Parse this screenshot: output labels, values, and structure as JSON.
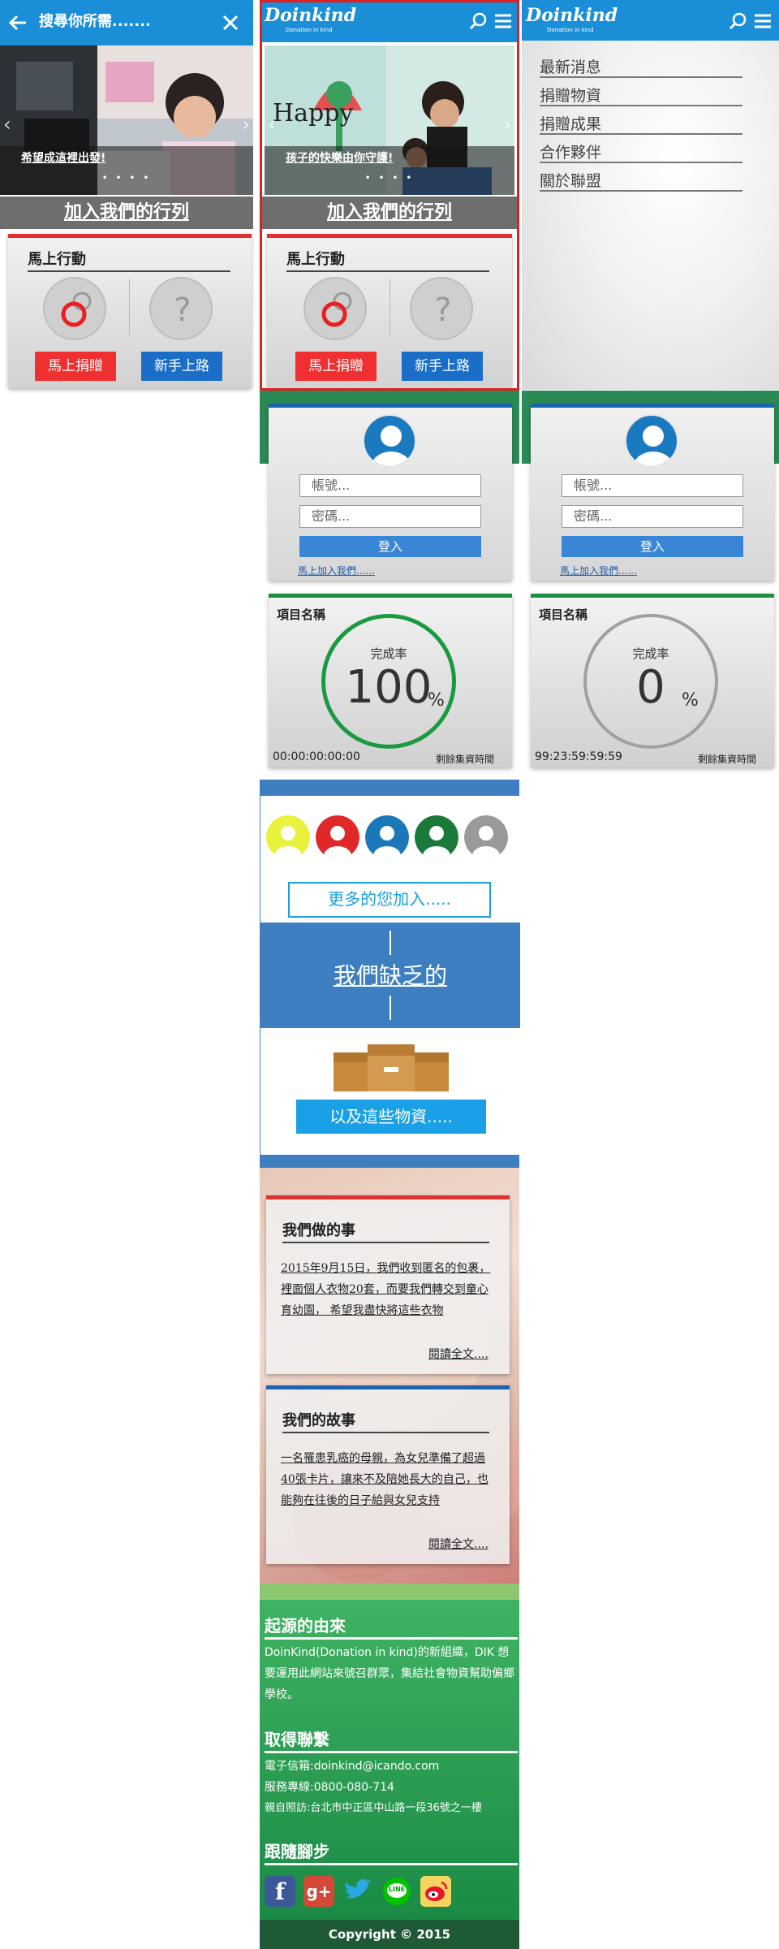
{
  "search_panel": {
    "title": "搜尋你所需.......",
    "slider_caption": "希望成這裡出發!",
    "slider_dots": "• • • •",
    "join_banner": "加入我們的行列",
    "action_card": {
      "title": "馬上行動",
      "donate_button": "馬上捐贈",
      "newbie_button": "新手上路"
    }
  },
  "home_panel": {
    "logo": "Doinkind",
    "logo_sub": "Donation in kind",
    "slider_caption": "孩子的快樂由你守護!",
    "slider_image_text": "Happy",
    "slider_dots": "• • • •",
    "join_banner": "加入我們的行列",
    "action_card": {
      "title": "馬上行動",
      "donate_button": "馬上捐贈",
      "newbie_button": "新手上路"
    },
    "login": {
      "username_placeholder": "帳號...",
      "password_placeholder": "密碼...",
      "login_button": "登入",
      "join_link": "馬上加入我們......"
    },
    "project": {
      "title": "項目名稱",
      "rate_label": "完成率",
      "rate_value": "100",
      "rate_unit": "%",
      "timer": "00:00:00:00:00",
      "timer_label": "剩餘集資時間"
    },
    "members": [
      "#e8f23c",
      "#e02828",
      "#1a78b8",
      "#1a7a3a",
      "#9a9a9a"
    ],
    "more_button": "更多的您加入.....",
    "lack_title": "我們缺乏的",
    "items_button": "以及這些物資.....",
    "what_we_do": {
      "title": "我們做的事",
      "text": "2015年9月15日，我們收到匿名的包裹，裡面個人衣物20套，而要我們轉交到童心育幼園， 希望我盡快將這些衣物",
      "read_more": "閱讀全文...."
    },
    "our_story": {
      "title": "我們的故事",
      "text": "一名罹患乳癌的母親，為女兒準備了超過40張卡片，讓來不及陪她長大的自己，也能夠在往後的日子給與女兒支持",
      "read_more": "閱讀全文...."
    },
    "footer": {
      "origin_title": "起源的由來",
      "origin_text": "DoinKind(Donation in kind)的新組織，DIK 想要運用此網站來號召群眾，集結社會物資幫助偏鄉學校。",
      "contact_title": "取得聯繫",
      "email": "電子信箱:doinkind@icando.com",
      "phone": "服務專線:0800-080-714",
      "address": "親自照訪:台北市中正區中山路一段36號之一樓",
      "follow_title": "跟隨腳步",
      "social": [
        "facebook",
        "google-plus",
        "twitter",
        "line",
        "weibo"
      ],
      "line_label": "LINE",
      "gplus_label": "g+",
      "fb_label": "f",
      "copyright": "Copyright © 2015"
    }
  },
  "menu_panel": {
    "logo": "Doinkind",
    "logo_sub": "Donation in kind",
    "items": [
      "最新消息",
      "捐贈物資",
      "捐贈成果",
      "合作夥伴",
      "關於聯盟"
    ],
    "login": {
      "username_placeholder": "帳號...",
      "password_placeholder": "密碼...",
      "login_button": "登入",
      "join_link": "馬上加入我們......"
    },
    "project": {
      "title": "項目名稱",
      "rate_label": "完成率",
      "rate_value": "0",
      "rate_unit": "%",
      "timer": "99:23:59:59:59",
      "timer_label": "剩餘集資時間"
    }
  },
  "colors": {
    "header_blue": "#1a8fd8",
    "accent_red": "#e03030",
    "button_blue": "#1a6ec8",
    "footer_green": "#2a9a55"
  }
}
